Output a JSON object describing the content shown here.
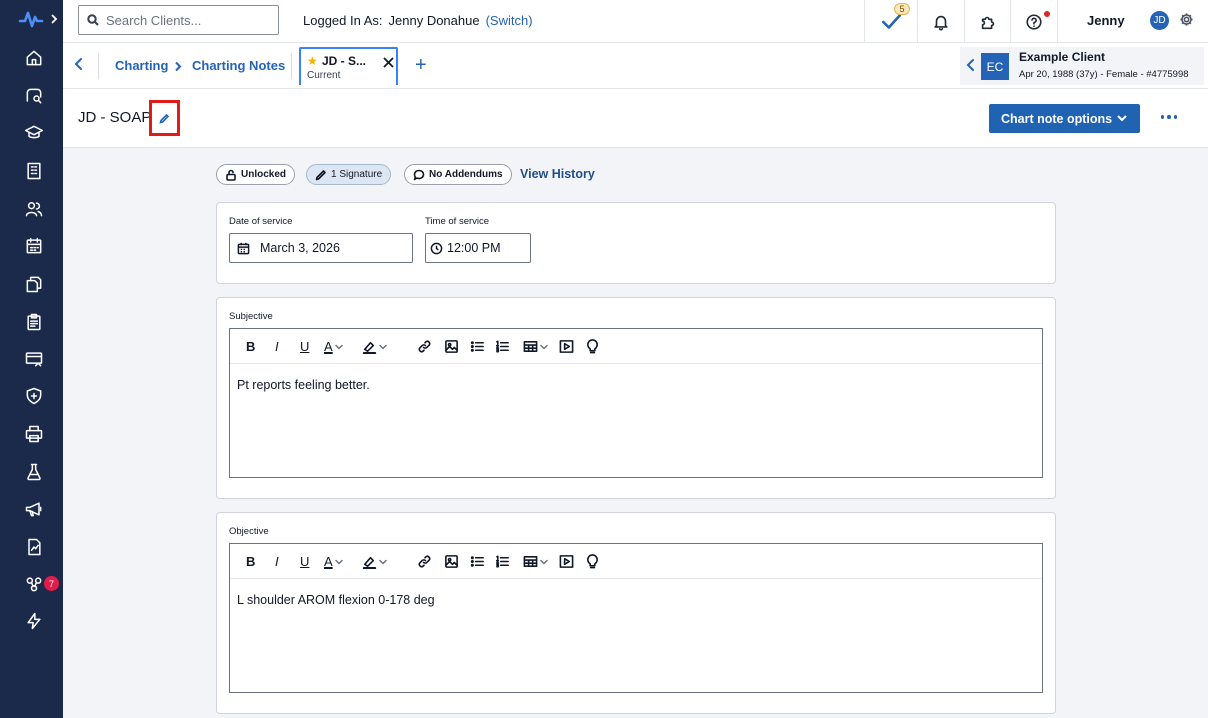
{
  "topbar": {
    "search_placeholder": "Search Clients...",
    "logged_in_label": "Logged In As:",
    "logged_in_user": "Jenny Donahue",
    "switch_label": "(Switch)",
    "tasks_count": "5",
    "user_first_name": "Jenny",
    "user_initials": "JD"
  },
  "rail": {
    "badge_count": "7",
    "items": [
      "home-icon",
      "search-client-icon",
      "learning-icon",
      "building-icon",
      "clients-icon",
      "calendar-icon",
      "documents-icon",
      "clipboard-icon",
      "billing-icon",
      "shield-icon",
      "print-icon",
      "lab-icon",
      "megaphone-icon",
      "reports-icon",
      "integrations-icon",
      "lightning-icon"
    ]
  },
  "tabbar": {
    "breadcrumb_1": "Charting",
    "breadcrumb_2": "Charting Notes",
    "tab_title": "JD - S...",
    "tab_subtitle": "Current",
    "add_tab": "+"
  },
  "client": {
    "initials": "EC",
    "name": "Example Client",
    "meta": "Apr 20, 1988 (37y) - Female - #4775998"
  },
  "page": {
    "title": "JD - SOAP",
    "options_label": "Chart note options"
  },
  "status": {
    "locked": "Unlocked",
    "signatures": "1 Signature",
    "addendums": "No Addendums",
    "history": "View History"
  },
  "service": {
    "date_label": "Date of service",
    "date_value": "March 3, 2026",
    "time_label": "Time of service",
    "time_value": "12:00 PM"
  },
  "sections": {
    "subjective": {
      "label": "Subjective",
      "text": "Pt reports feeling better."
    },
    "objective": {
      "label": "Objective",
      "text": "L shoulder AROM flexion 0-178 deg"
    }
  },
  "toolbar": {
    "bold": "B",
    "italic": "I",
    "underline": "U",
    "font_color": "A"
  },
  "colors": {
    "rail_bg": "#1b2a4a",
    "accent": "#2463b5",
    "primary_button": "#2063b3",
    "highlight_box": "#e21a1a",
    "badge_red": "#e11d48"
  }
}
